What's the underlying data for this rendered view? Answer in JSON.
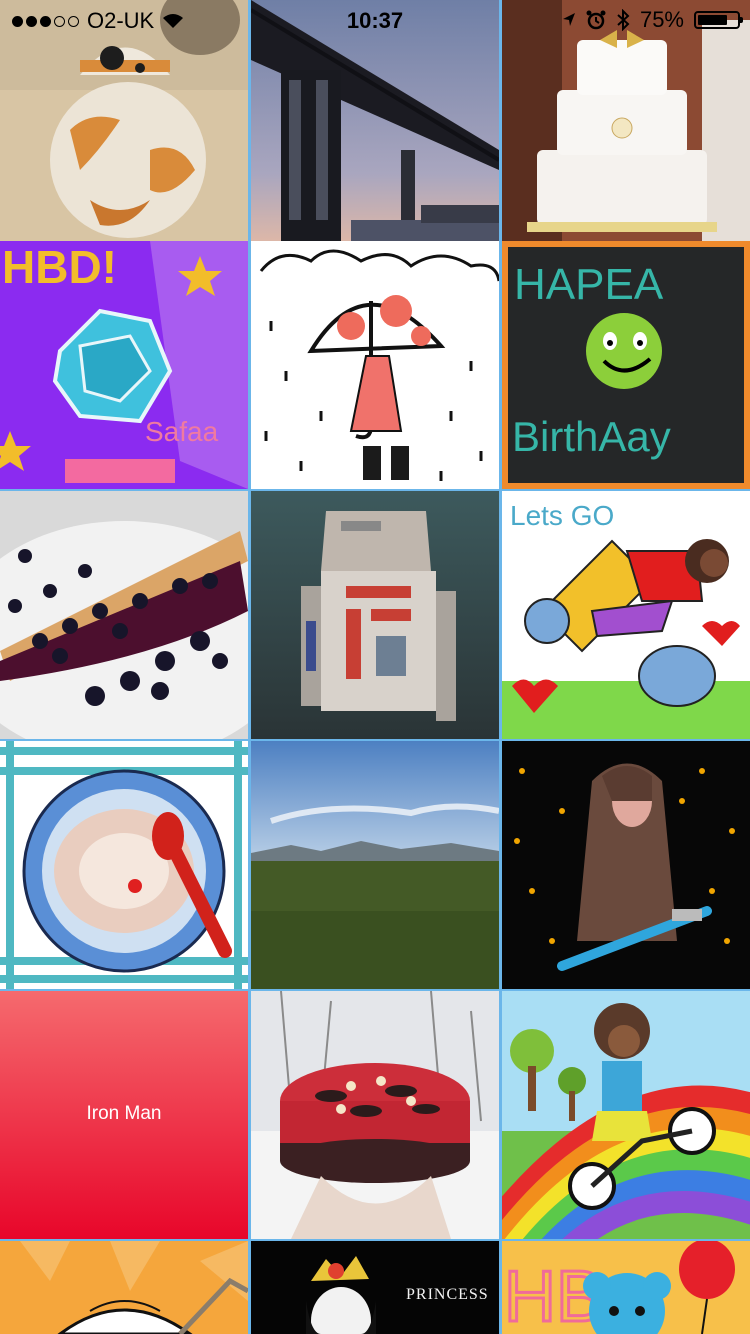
{
  "status_bar": {
    "carrier": "O2-UK",
    "time": "10:37",
    "battery_percent": "75%",
    "battery_level": 0.75,
    "signal_bars_filled": 3,
    "signal_bars_total": 5
  },
  "gallery": {
    "tiles": [
      {
        "name": "bb8-droid-photo",
        "icon": "photo"
      },
      {
        "name": "bridge-photo",
        "icon": "photo"
      },
      {
        "name": "wedding-cake-photo",
        "icon": "photo"
      },
      {
        "name": "hbd-gem-drawing",
        "icon": "drawing"
      },
      {
        "name": "umbrella-rain-drawing",
        "icon": "drawing"
      },
      {
        "name": "smiley-birthday-drawing",
        "icon": "drawing"
      },
      {
        "name": "blueberry-tart-photo",
        "icon": "photo"
      },
      {
        "name": "r2-droid-photo",
        "icon": "photo"
      },
      {
        "name": "lets-go-drawing",
        "icon": "drawing"
      },
      {
        "name": "porridge-drawing",
        "icon": "drawing"
      },
      {
        "name": "field-landscape-photo",
        "icon": "photo"
      },
      {
        "name": "jedi-lightsaber-drawing",
        "icon": "drawing"
      },
      {
        "name": "iron-man-tile",
        "label": "Iron Man"
      },
      {
        "name": "red-cheesecake-photo",
        "icon": "photo"
      },
      {
        "name": "rainbow-bike-drawing",
        "icon": "drawing"
      },
      {
        "name": "sun-drawing",
        "icon": "drawing"
      },
      {
        "name": "princess-drawing",
        "icon": "drawing"
      },
      {
        "name": "hb-bear-drawing",
        "icon": "drawing"
      }
    ],
    "drawn_text": {
      "hbd": "HBD!",
      "safaa": "Safaa",
      "hapea": "HAPEA",
      "birthday": "BirthAay",
      "lets_go": "Lets GO",
      "princess": "PRINCESS",
      "hb": "HB"
    }
  },
  "colors": {
    "grid_separator": "#6bb6ea",
    "iron_man_top": "#f56a6e",
    "iron_man_bottom": "#e8062a"
  }
}
